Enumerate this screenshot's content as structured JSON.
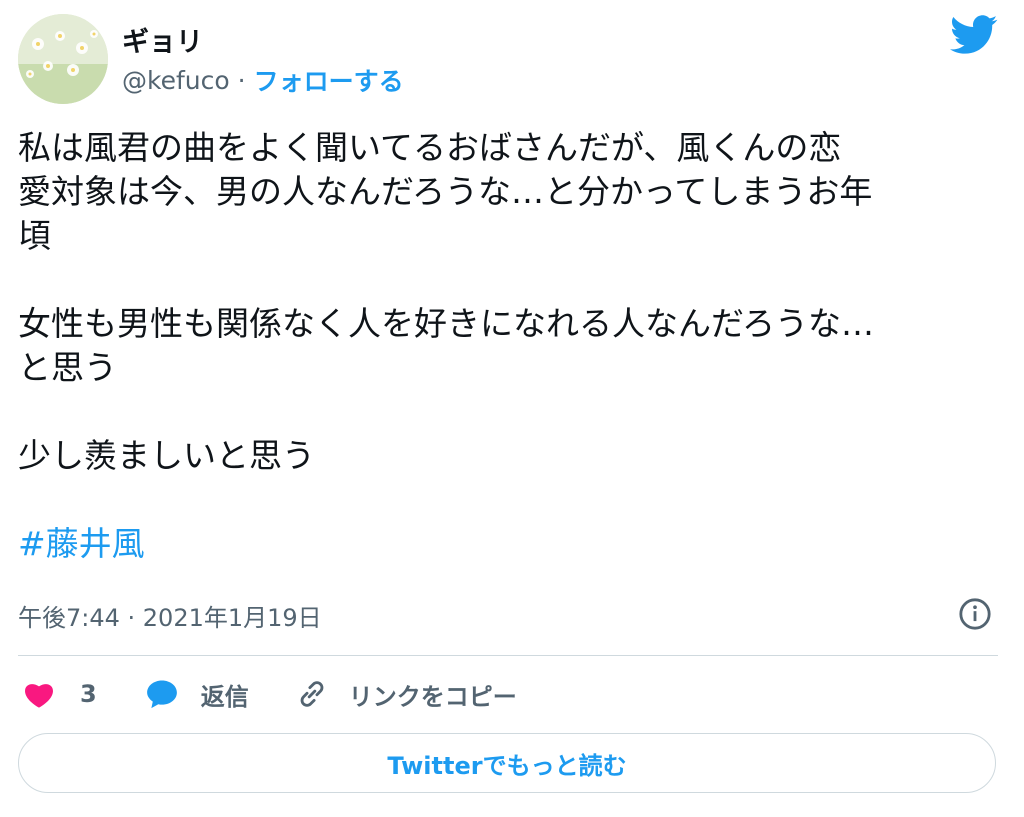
{
  "author": {
    "name": "ギョリ",
    "handle": "@kefuco",
    "separator": "·",
    "follow_label": "フォローする"
  },
  "tweet": {
    "text": "私は風君の曲をよく聞いてるおばさんだが、風くんの恋\n愛対象は今、男の人なんだろうな…と分かってしまうお年\n頃\n\n女性も男性も関係なく人を好きになれる人なんだろうな…\nと思う\n\n少し羨ましいと思う\n\n",
    "hashtag": "#藤井風"
  },
  "meta": {
    "timestamp": "午後7:44 · 2021年1月19日"
  },
  "actions": {
    "like_count": "3",
    "reply_label": "返信",
    "copy_link_label": "リンクをコピー"
  },
  "read_more_label": "Twitterでもっと読む",
  "colors": {
    "accent": "#1d9bf0",
    "heart": "#f91880",
    "secondary_text": "#536471",
    "divider": "#cfd9de"
  },
  "icons": [
    "twitter-bird-icon",
    "info-icon",
    "heart-icon",
    "reply-bubble-icon",
    "link-icon"
  ]
}
